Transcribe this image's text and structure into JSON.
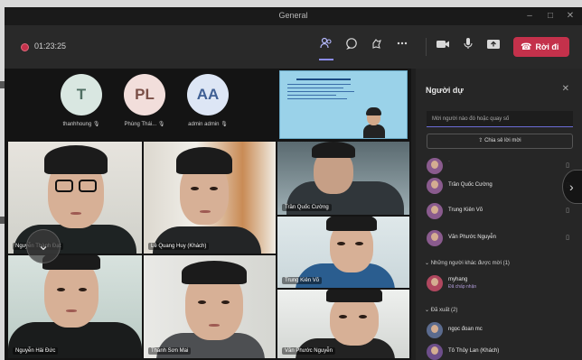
{
  "window": {
    "title": "General",
    "controls": [
      "–",
      "□",
      "✕"
    ]
  },
  "toolbar": {
    "timer": "01:23:25",
    "leave_label": "Rời đi",
    "icons": [
      "participants-icon",
      "chat-icon",
      "reactions-icon",
      "more-icon",
      "camera-icon",
      "mic-icon",
      "share-icon"
    ]
  },
  "avatars": [
    {
      "initials": "T",
      "name": "thanhhoung",
      "color": "#d9e7e1",
      "text_color": "#4f6e62"
    },
    {
      "initials": "PL",
      "name": "Phùng Thái...",
      "color": "#f2dedb",
      "text_color": "#7a4f47"
    },
    {
      "initials": "AA",
      "name": "admin admin",
      "color": "#dde6f5",
      "text_color": "#3f5f94"
    }
  ],
  "tiles": [
    {
      "name": "Nguyễn Thành Đạt"
    },
    {
      "name": "Lê Quang Huy (Khách)"
    },
    {
      "name": "Trần Quốc Cường"
    },
    {
      "name": "Trung Kiên Võ"
    },
    {
      "name": "Nguyễn Hải Đức"
    },
    {
      "name": "Thanh Sơn Mai"
    },
    {
      "name": "Văn Phước Nguyễn"
    }
  ],
  "panel": {
    "title": "Người dự",
    "search_placeholder": "Mời người nào đó hoặc quay số",
    "invite_label": "Chia sẻ lời mời",
    "participants_top": [
      {
        "name": "Trần Quốc Cường"
      },
      {
        "name": "Trung Kiên Võ"
      },
      {
        "name": "Văn Phước Nguyễn"
      }
    ],
    "section_others": "Những người khác được mời (1)",
    "other_person": {
      "name": "myhang",
      "sub": "Đã chấp nhận"
    },
    "section_absent": "Đã xuất (2)",
    "absent": [
      {
        "name": "ngọc đoan mc"
      },
      {
        "name": "Tô Thủy Lan (Khách)"
      }
    ]
  }
}
